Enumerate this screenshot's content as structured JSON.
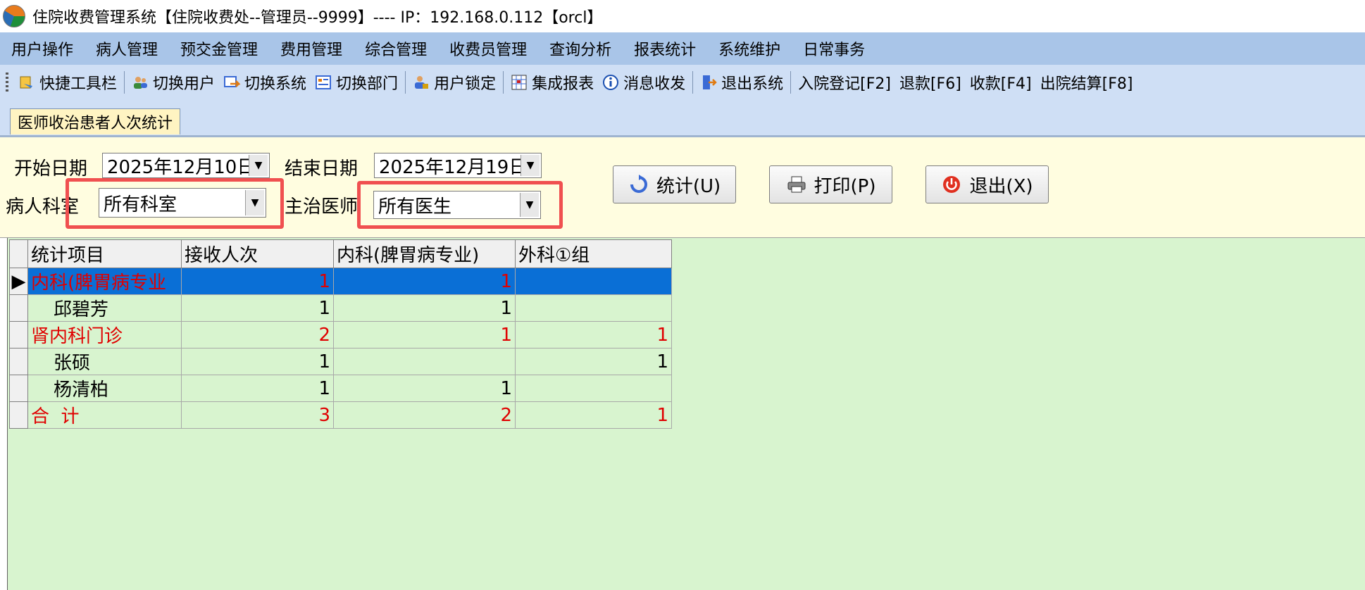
{
  "window": {
    "title": "住院收费管理系统【住院收费处--管理员--9999】---- IP：192.168.0.112【orcl】"
  },
  "menu": [
    "用户操作",
    "病人管理",
    "预交金管理",
    "费用管理",
    "综合管理",
    "收费员管理",
    "查询分析",
    "报表统计",
    "系统维护",
    "日常事务"
  ],
  "toolbar": {
    "quick": "快捷工具栏",
    "switch_user": "切换用户",
    "switch_system": "切换系统",
    "switch_dept": "切换部门",
    "lock_user": "用户锁定",
    "report": "集成报表",
    "message": "消息收发",
    "exit": "退出系统",
    "admit": "入院登记[F2]",
    "refund": "退款[F6]",
    "collect": "收款[F4]",
    "discharge": "出院结算[F8]"
  },
  "tab": {
    "label": "医师收治患者人次统计"
  },
  "filter": {
    "start_label": "开始日期",
    "start_value": "2025年12月10日",
    "end_label": "结束日期",
    "end_value": "2025年12月19日",
    "dept_label": "病人科室",
    "dept_value": "所有科室",
    "doctor_label": "主治医师",
    "doctor_value": "所有医生"
  },
  "buttons": {
    "stat": "统计(U)",
    "print": "打印(P)",
    "exit": "退出(X)"
  },
  "grid": {
    "headers": [
      "统计项目",
      "接收人次",
      "内科(脾胃病专业)",
      "外科①组"
    ],
    "rows": [
      {
        "item": "内科(脾胃病专业",
        "total": "1",
        "c1": "1",
        "c2": "",
        "kind": "dept"
      },
      {
        "item": "邱碧芳",
        "total": "1",
        "c1": "1",
        "c2": "",
        "kind": "doctor"
      },
      {
        "item": "肾内科门诊",
        "total": "2",
        "c1": "1",
        "c2": "1",
        "kind": "dept"
      },
      {
        "item": "张硕",
        "total": "1",
        "c1": "",
        "c2": "1",
        "kind": "doctor"
      },
      {
        "item": "杨清柏",
        "total": "1",
        "c1": "1",
        "c2": "",
        "kind": "doctor"
      },
      {
        "item": "合  计",
        "total": "3",
        "c1": "2",
        "c2": "1",
        "kind": "total"
      }
    ]
  },
  "colors": {
    "highlight": "#f05050",
    "selection": "#0a6fd6",
    "grid_bg": "#d8f4cf"
  }
}
